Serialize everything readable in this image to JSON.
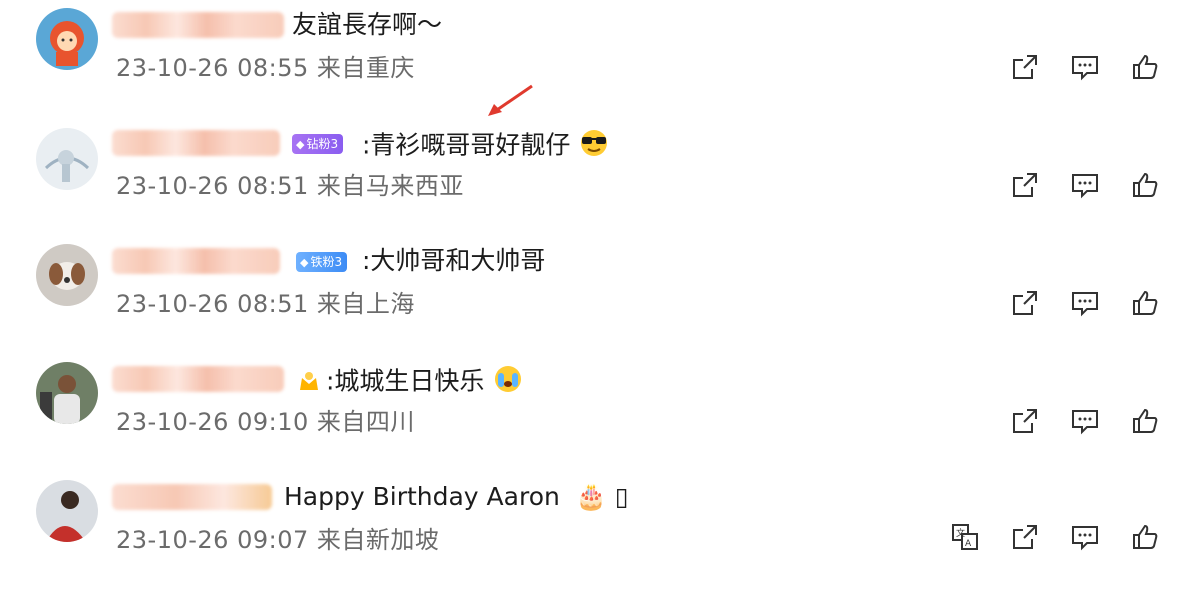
{
  "comments": [
    {
      "text": "友誼長存啊～",
      "time": "23-10-26 08:55",
      "location": "来自重庆"
    },
    {
      "badge": "钻粉3",
      "text": ":青衫嘅哥哥好靓仔",
      "time": "23-10-26 08:51",
      "location": "来自马来西亚"
    },
    {
      "badge": "铁粉3",
      "text": ":大帅哥和大帅哥",
      "time": "23-10-26 08:51",
      "location": "来自上海"
    },
    {
      "text": ":城城生日快乐",
      "time": "23-10-26 09:10",
      "location": "来自四川"
    },
    {
      "text": "Happy Birthday  Aaron",
      "trailing": "🎂 ▯",
      "time": "23-10-26 09:07",
      "location": "来自新加坡"
    }
  ],
  "icons": {
    "share": "share-icon",
    "comment": "comment-icon",
    "like": "thumbs-up-icon",
    "translate": "translate-icon"
  },
  "colors": {
    "badge_purple": "#9a67f2",
    "badge_blue": "#4a95f7",
    "arrow": "#e03a2e",
    "meta_text": "#6b6b6b",
    "icon_stroke": "#333333"
  }
}
